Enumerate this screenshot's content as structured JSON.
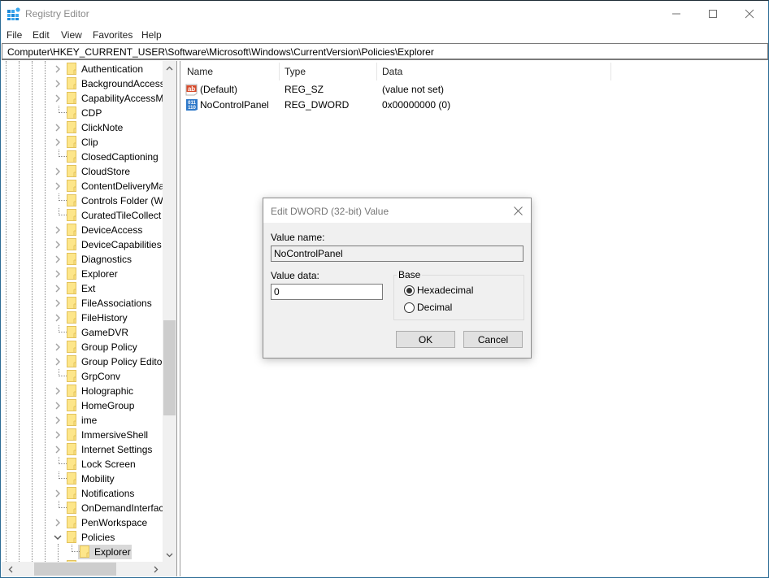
{
  "window": {
    "title": "Registry Editor",
    "icon": "registry-editor-icon"
  },
  "menu": {
    "items": [
      "File",
      "Edit",
      "View",
      "Favorites",
      "Help"
    ]
  },
  "address": {
    "path": "Computer\\HKEY_CURRENT_USER\\Software\\Microsoft\\Windows\\CurrentVersion\\Policies\\Explorer"
  },
  "tree": {
    "items": [
      {
        "label": "Authentication",
        "expandable": true
      },
      {
        "label": "BackgroundAccess",
        "expandable": true
      },
      {
        "label": "CapabilityAccessM",
        "expandable": true
      },
      {
        "label": "CDP",
        "expandable": false
      },
      {
        "label": "ClickNote",
        "expandable": true
      },
      {
        "label": "Clip",
        "expandable": true
      },
      {
        "label": "ClosedCaptioning",
        "expandable": false
      },
      {
        "label": "CloudStore",
        "expandable": true
      },
      {
        "label": "ContentDeliveryMa",
        "expandable": true
      },
      {
        "label": "Controls Folder (W",
        "expandable": false
      },
      {
        "label": "CuratedTileCollect",
        "expandable": false
      },
      {
        "label": "DeviceAccess",
        "expandable": true
      },
      {
        "label": "DeviceCapabilities",
        "expandable": true
      },
      {
        "label": "Diagnostics",
        "expandable": true
      },
      {
        "label": "Explorer",
        "expandable": true
      },
      {
        "label": "Ext",
        "expandable": true
      },
      {
        "label": "FileAssociations",
        "expandable": true
      },
      {
        "label": "FileHistory",
        "expandable": true
      },
      {
        "label": "GameDVR",
        "expandable": false
      },
      {
        "label": "Group Policy",
        "expandable": true
      },
      {
        "label": "Group Policy Edito",
        "expandable": true
      },
      {
        "label": "GrpConv",
        "expandable": false
      },
      {
        "label": "Holographic",
        "expandable": true
      },
      {
        "label": "HomeGroup",
        "expandable": true
      },
      {
        "label": "ime",
        "expandable": true
      },
      {
        "label": "ImmersiveShell",
        "expandable": true
      },
      {
        "label": "Internet Settings",
        "expandable": true
      },
      {
        "label": "Lock Screen",
        "expandable": false
      },
      {
        "label": "Mobility",
        "expandable": false
      },
      {
        "label": "Notifications",
        "expandable": true
      },
      {
        "label": "OnDemandInterfac",
        "expandable": false
      },
      {
        "label": "PenWorkspace",
        "expandable": true
      },
      {
        "label": "Policies",
        "expandable": true,
        "expanded": true
      }
    ],
    "selected_child": {
      "label": "Explorer"
    }
  },
  "list": {
    "columns": [
      "Name",
      "Type",
      "Data"
    ],
    "rows": [
      {
        "icon": "string-value-icon",
        "name": "(Default)",
        "type": "REG_SZ",
        "data": "(value not set)"
      },
      {
        "icon": "binary-value-icon",
        "name": "NoControlPanel",
        "type": "REG_DWORD",
        "data": "0x00000000 (0)"
      }
    ]
  },
  "dialog": {
    "title": "Edit DWORD (32-bit) Value",
    "value_name_label": "Value name:",
    "value_name": "NoControlPanel",
    "value_data_label": "Value data:",
    "value_data": "0",
    "base_label": "Base",
    "base_options": [
      {
        "label": "Hexadecimal",
        "selected": true
      },
      {
        "label": "Decimal",
        "selected": false
      }
    ],
    "ok_label": "OK",
    "cancel_label": "Cancel"
  }
}
